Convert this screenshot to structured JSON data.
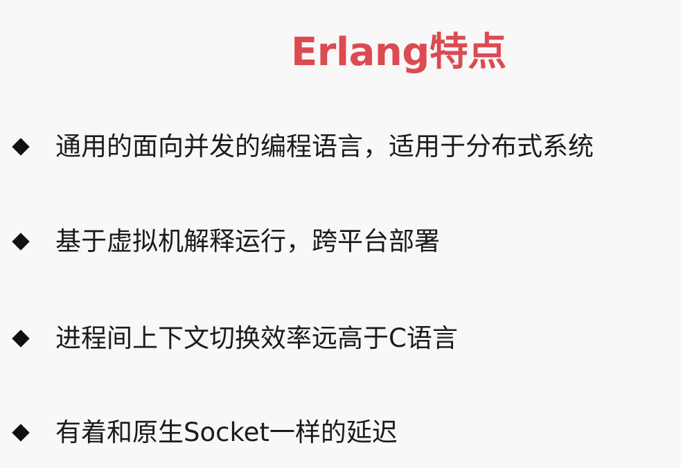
{
  "slide": {
    "title": "Erlang特点",
    "title_color": "#dc4a52",
    "bullet_icon": "diamond-bullet-icon",
    "bullets": [
      {
        "text": "通用的面向并发的编程语言，适用于分布式系统"
      },
      {
        "text": "基于虚拟机解释运行，跨平台部署"
      },
      {
        "text": "进程间上下文切换效率远高于C语言"
      },
      {
        "text": "有着和原生Socket一样的延迟"
      }
    ]
  }
}
